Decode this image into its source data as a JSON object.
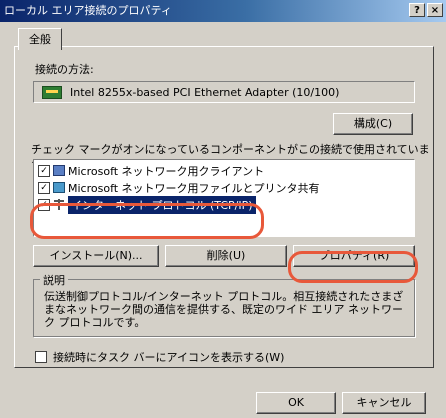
{
  "window": {
    "title": "ローカル エリア接続のプロパティ",
    "help_button": "?",
    "close_button": "×"
  },
  "tabs": [
    {
      "label": "全般"
    }
  ],
  "connection": {
    "label": "接続の方法:",
    "adapter": "Intel 8255x-based PCI Ethernet Adapter (10/100)"
  },
  "buttons": {
    "configure": "構成(C)",
    "install": "インストール(N)...",
    "uninstall": "削除(U)",
    "properties": "プロパティ(R)",
    "ok": "OK",
    "cancel": "キャンセル"
  },
  "components": {
    "label": "チェック マークがオンになっているコンポーネントがこの接続で使用されています(O):",
    "items": [
      {
        "checked": true,
        "icon": "client-icon",
        "label": "Microsoft ネットワーク用クライアント"
      },
      {
        "checked": true,
        "icon": "file-share-icon",
        "label": "Microsoft ネットワーク用ファイルとプリンタ共有"
      },
      {
        "checked": true,
        "icon": "protocol-icon",
        "label": "インターネット プロトコル (TCP/IP)",
        "selected": true
      }
    ]
  },
  "description": {
    "legend": "説明",
    "text": "伝送制御プロトコル/インターネット プロトコル。相互接続されたさまざまなネットワーク間の通信を提供する、既定のワイド エリア ネットワーク プロトコルです。"
  },
  "taskbar_option": {
    "checked": false,
    "label": "接続時にタスク バーにアイコンを表示する(W)"
  },
  "colors": {
    "highlight": "#e8583a",
    "selection": "#0a246a"
  }
}
